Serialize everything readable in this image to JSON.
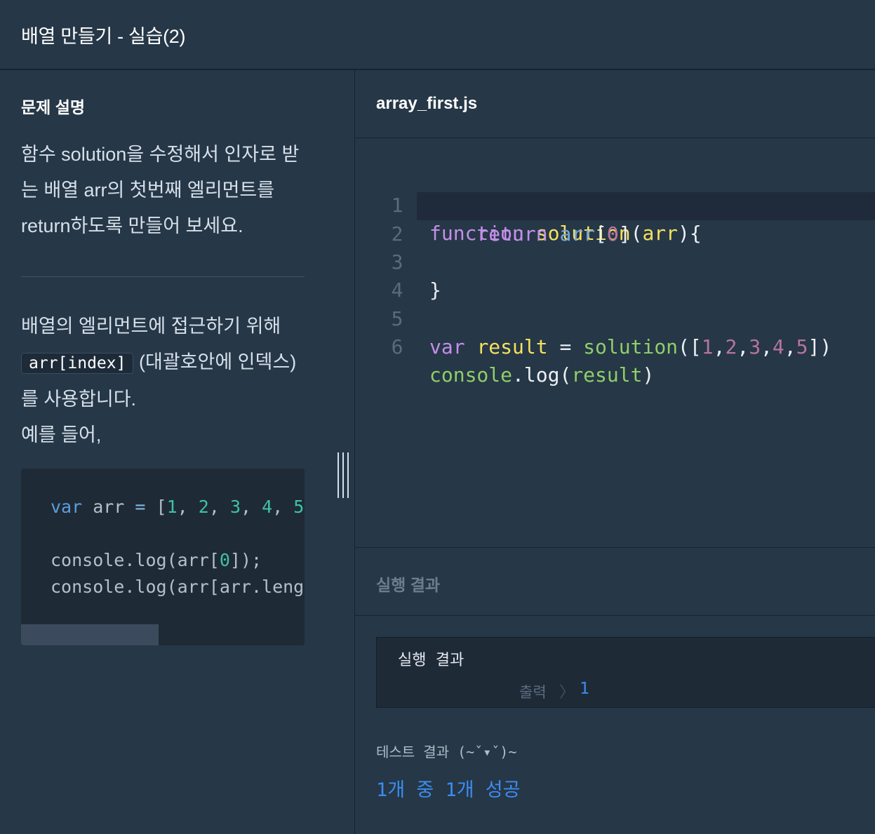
{
  "header": {
    "title": "배열 만들기 - 실습(2)"
  },
  "description": {
    "section_title": "문제 설명",
    "paragraph1": "함수 solution을 수정해서 인자로 받는 배열 arr의 첫번째 엘리먼트를 return하도록 만들어 보세요.",
    "paragraph2_before": "배열의 엘리먼트에 접근하기 위해 ",
    "inline_code": "arr[index]",
    "paragraph2_after": " (대괄호안에 인덱스)를 사용합니다.",
    "paragraph3": "예를 들어,",
    "example_code": {
      "line1": {
        "kw": "var",
        "ident": " arr ",
        "op": "=",
        "open": " [",
        "nums": [
          "1",
          "2",
          "3",
          "4",
          "5"
        ]
      },
      "line2": {
        "pre": "console.log(arr[",
        "num": "0",
        "post": "]);"
      },
      "line3": "console.log(arr[arr.leng"
    }
  },
  "editor": {
    "filename": "array_first.js",
    "line_numbers": [
      "1",
      "2",
      "3",
      "4",
      "5",
      "6"
    ],
    "active_line": 2
  },
  "result": {
    "tab_label": "실행 결과",
    "box_heading": "실행 결과",
    "output_label": "출력",
    "output_value": "1",
    "test_label": "테스트 결과 (~ˇ▾ˇ)~",
    "test_value": "1개 중 1개 성공"
  },
  "colors": {
    "background": "#263747",
    "code_background": "#1f2a37",
    "accent_blue": "#3c8cf0"
  },
  "icons": {
    "drag_handle": "vertical-grip-icon",
    "chevron": "chevron-right-icon"
  }
}
